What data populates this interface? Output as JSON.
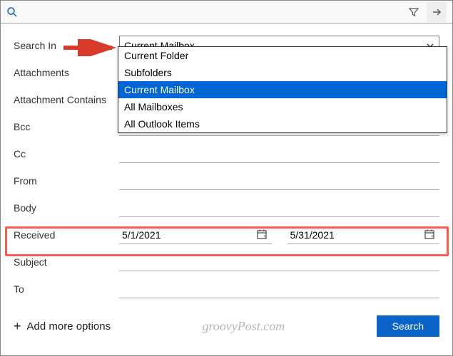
{
  "topbar": {
    "search_value": ""
  },
  "form": {
    "search_in": {
      "label": "Search In",
      "selected": "Current Mailbox",
      "options": [
        "Current Folder",
        "Subfolders",
        "Current Mailbox",
        "All Mailboxes",
        "All Outlook Items"
      ],
      "selected_index": 2
    },
    "attachments": {
      "label": "Attachments",
      "value": ""
    },
    "attachment_contains": {
      "label": "Attachment Contains",
      "value": ""
    },
    "bcc": {
      "label": "Bcc",
      "value": ""
    },
    "cc": {
      "label": "Cc",
      "value": ""
    },
    "from": {
      "label": "From",
      "value": ""
    },
    "body": {
      "label": "Body",
      "value": ""
    },
    "received": {
      "label": "Received",
      "start": "5/1/2021",
      "end": "5/31/2021"
    },
    "subject": {
      "label": "Subject",
      "value": ""
    },
    "to": {
      "label": "To",
      "value": ""
    }
  },
  "actions": {
    "add_more": "Add more options",
    "search": "Search"
  },
  "watermark": "groovyPost.com"
}
